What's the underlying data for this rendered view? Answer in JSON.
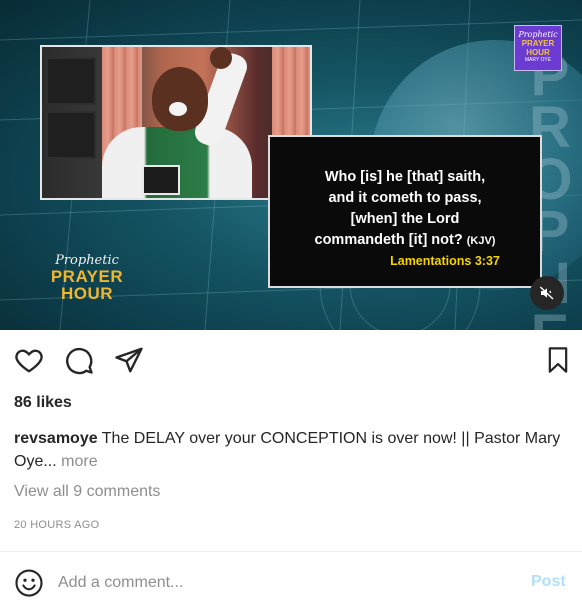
{
  "media": {
    "verse": {
      "line1": "Who [is] he [that] saith,",
      "line2": "and it cometh to pass,",
      "line3": "[when] the Lord",
      "line4": "commandeth [it] not?",
      "version": "(KJV)",
      "reference": "Lamentations 3:37"
    },
    "brand": {
      "script": "Prophetic",
      "line1": "PRAYER",
      "line2": "HOUR"
    },
    "badge": {
      "script": "Prophetic",
      "line1": "PRAYER",
      "line2": "HOUR",
      "sub": "MARY OYE"
    },
    "side_text": "PROPHETIC"
  },
  "actions": {
    "like_icon": "heart-icon",
    "comment_icon": "comment-icon",
    "share_icon": "paper-plane-icon",
    "save_icon": "bookmark-icon",
    "mute_icon": "speaker-muted-icon"
  },
  "post": {
    "likes": "86 likes",
    "username": "revsamoye",
    "caption": "The DELAY over your CONCEPTION is over now! || Pastor Mary Oye...",
    "more_label": "more",
    "view_comments": "View all 9 comments",
    "timestamp": "20 HOURS AGO"
  },
  "comment_box": {
    "placeholder": "Add a comment...",
    "value": "",
    "post_label": "Post"
  },
  "colors": {
    "accent_disabled": "#b2dffc",
    "text": "#262626",
    "muted": "#8e8e8e",
    "verse_reference": "#f5d400",
    "brand_gold": "#f0b62c",
    "badge_purple": "#6c3bd1"
  }
}
